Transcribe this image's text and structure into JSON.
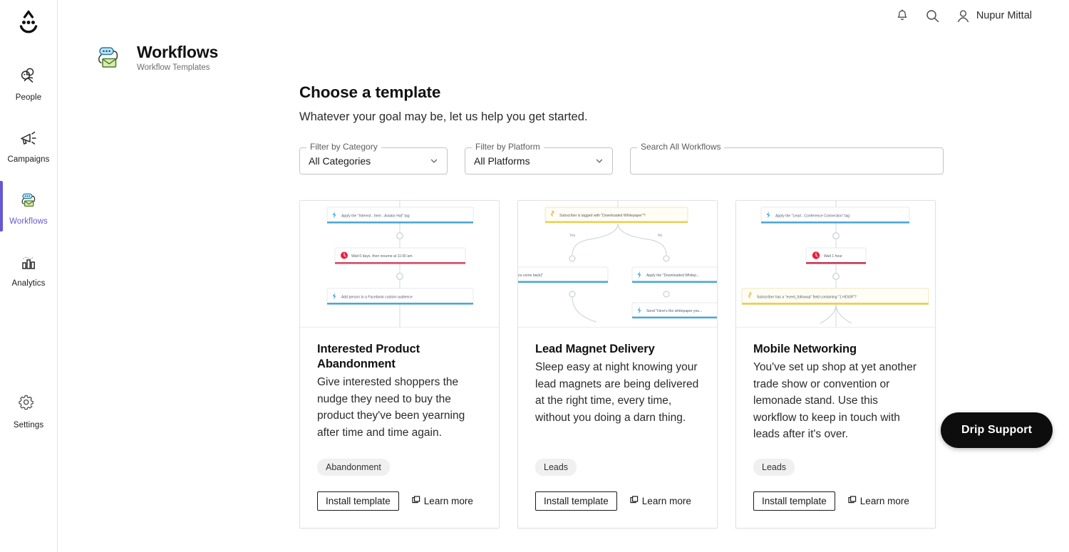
{
  "brand": {
    "logo_icon": "drip-smiley-logo",
    "accent_purple": "#6558d3",
    "support_bg": "#0d0d0d"
  },
  "sidebar": {
    "items": [
      {
        "label": "People",
        "icon": "people-icon",
        "active": false
      },
      {
        "label": "Campaigns",
        "icon": "megaphone-icon",
        "active": false
      },
      {
        "label": "Workflows",
        "icon": "workflow-icon",
        "active": true
      },
      {
        "label": "Analytics",
        "icon": "bar-chart-icon",
        "active": false
      }
    ],
    "settings": {
      "label": "Settings",
      "icon": "gear-icon"
    }
  },
  "topbar": {
    "notifications_icon": "bell-icon",
    "search_icon": "search-icon",
    "avatar_icon": "user-avatar-icon",
    "user_name": "Nupur Mittal"
  },
  "page_header": {
    "icon": "workflow-icon",
    "title": "Workflows",
    "subtitle": "Workflow Templates"
  },
  "content": {
    "heading": "Choose a template",
    "subheading": "Whatever your goal may be, let us help you get started."
  },
  "filters": {
    "category": {
      "label": "Filter by Category",
      "value": "All Categories",
      "caret_icon": "chevron-down-icon"
    },
    "platform": {
      "label": "Filter by Platform",
      "value": "All Platforms",
      "caret_icon": "chevron-down-icon"
    },
    "search": {
      "label": "Search All Workflows",
      "value": "",
      "placeholder": ""
    }
  },
  "cards": [
    {
      "title": "Interested Product Abandonment",
      "description": "Give interested shoppers the nudge they need to buy the product they've been yearning after time and time again.",
      "tag": "Abandonment",
      "install_label": "Install template",
      "learn_label": "Learn more",
      "learn_icon": "external-window-icon",
      "preview": {
        "type": "linear",
        "nodes": [
          {
            "text": "Apply the \"Interest - Item - Aviator Hat\" tag",
            "accent": "#4da7d8",
            "icon": "bolt-icon"
          },
          {
            "text": "Wait 0 days, then resume at 11:00 am",
            "accent": "#d44a63",
            "icon": "clock-icon"
          },
          {
            "text": "Add person to a Facebook custom audience",
            "accent": "#4da7d8",
            "icon": "bolt-icon"
          }
        ]
      }
    },
    {
      "title": "Lead Magnet Delivery",
      "description": "Sleep easy at night knowing your lead magnets are being delivered at the right time, every time, without you doing a darn thing.",
      "tag": "Leads",
      "install_label": "Install template",
      "learn_label": "Learn more",
      "learn_icon": "external-window-icon",
      "preview": {
        "type": "branch",
        "root": {
          "text": "Subscriber is tagged with \"Downloaded Whitepaper\"?",
          "accent": "#e9cf59",
          "icon": "question-icon"
        },
        "branch_labels": [
          "Yes",
          "No"
        ],
        "left_node": {
          "text": "...whitepaper (glad you come back)\"",
          "accent": "#4da7d8",
          "icon": "bolt-icon"
        },
        "right_node": {
          "text": "Apply the \"Downloaded Whitep...",
          "accent": "#4da7d8",
          "icon": "bolt-icon"
        },
        "right_node2": {
          "text": "Send \"Here's the whitepaper you...",
          "accent": "#4da7d8",
          "icon": "bolt-icon"
        }
      }
    },
    {
      "title": "Mobile Networking",
      "description": "You've set up shop at yet another trade show or convention or lemonade stand. Use this workflow to keep in touch with leads after it's over.",
      "tag": "Leads",
      "install_label": "Install template",
      "learn_label": "Learn more",
      "learn_icon": "external-window-icon",
      "preview": {
        "type": "linear",
        "nodes": [
          {
            "text": "Apply the \"Lead - Conference Connection\" tag",
            "accent": "#4da7d8",
            "icon": "bolt-icon"
          },
          {
            "text": "Wait 1 hour",
            "accent": "#d44a63",
            "icon": "clock-icon"
          },
          {
            "text": "Subscriber has a \"event_followup\" field containing \"1 HOUR\"?",
            "accent": "#e9cf59",
            "icon": "question-icon"
          }
        ]
      }
    }
  ],
  "support": {
    "label": "Drip Support"
  }
}
